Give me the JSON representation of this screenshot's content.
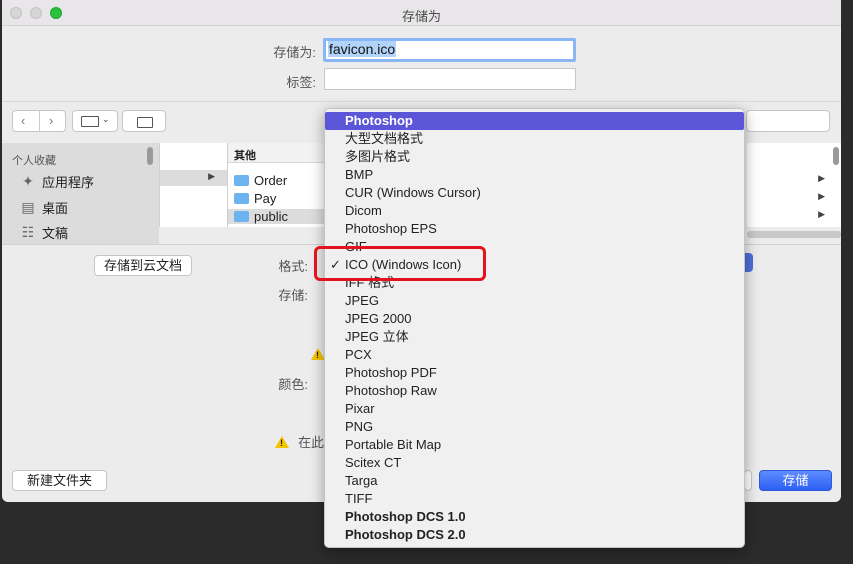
{
  "window": {
    "title": "存储为"
  },
  "form": {
    "save_as_label": "存储为:",
    "save_as_value": "favicon.ico",
    "tags_label": "标签:",
    "tags_value": ""
  },
  "sidebar": {
    "heading": "个人收藏",
    "items": [
      {
        "label": "应用程序",
        "icon": "applications-icon"
      },
      {
        "label": "桌面",
        "icon": "desktop-icon"
      },
      {
        "label": "文稿",
        "icon": "documents-icon"
      }
    ]
  },
  "browser": {
    "column_header": "其他",
    "folders": [
      "Order",
      "Pay",
      "public"
    ],
    "selected_folder": "public"
  },
  "options": {
    "save_to_cloud_button": "存储到云文档",
    "format_label": "格式:",
    "storage_label": "存储:",
    "color_label": "颜色:",
    "warning_text": "在此"
  },
  "footer": {
    "new_folder_button": "新建文件夹",
    "save_button": "存储"
  },
  "format_menu": {
    "selected": "ICO (Windows Icon)",
    "highlighted": "Photoshop",
    "items": [
      "Photoshop",
      "大型文档格式",
      "多图片格式",
      "BMP",
      "CUR (Windows Cursor)",
      "Dicom",
      "Photoshop EPS",
      "GIF",
      "ICO (Windows Icon)",
      "IFF 格式",
      "JPEG",
      "JPEG 2000",
      "JPEG 立体",
      "PCX",
      "Photoshop PDF",
      "Photoshop Raw",
      "Pixar",
      "PNG",
      "Portable Bit Map",
      "Scitex CT",
      "Targa",
      "TIFF",
      "Photoshop DCS 1.0",
      "Photoshop DCS 2.0"
    ],
    "check_glyph": "✓"
  },
  "colors": {
    "highlight": "#5b55d8",
    "annotation_box": "#e3131d",
    "primary_button": "#3770ff"
  }
}
